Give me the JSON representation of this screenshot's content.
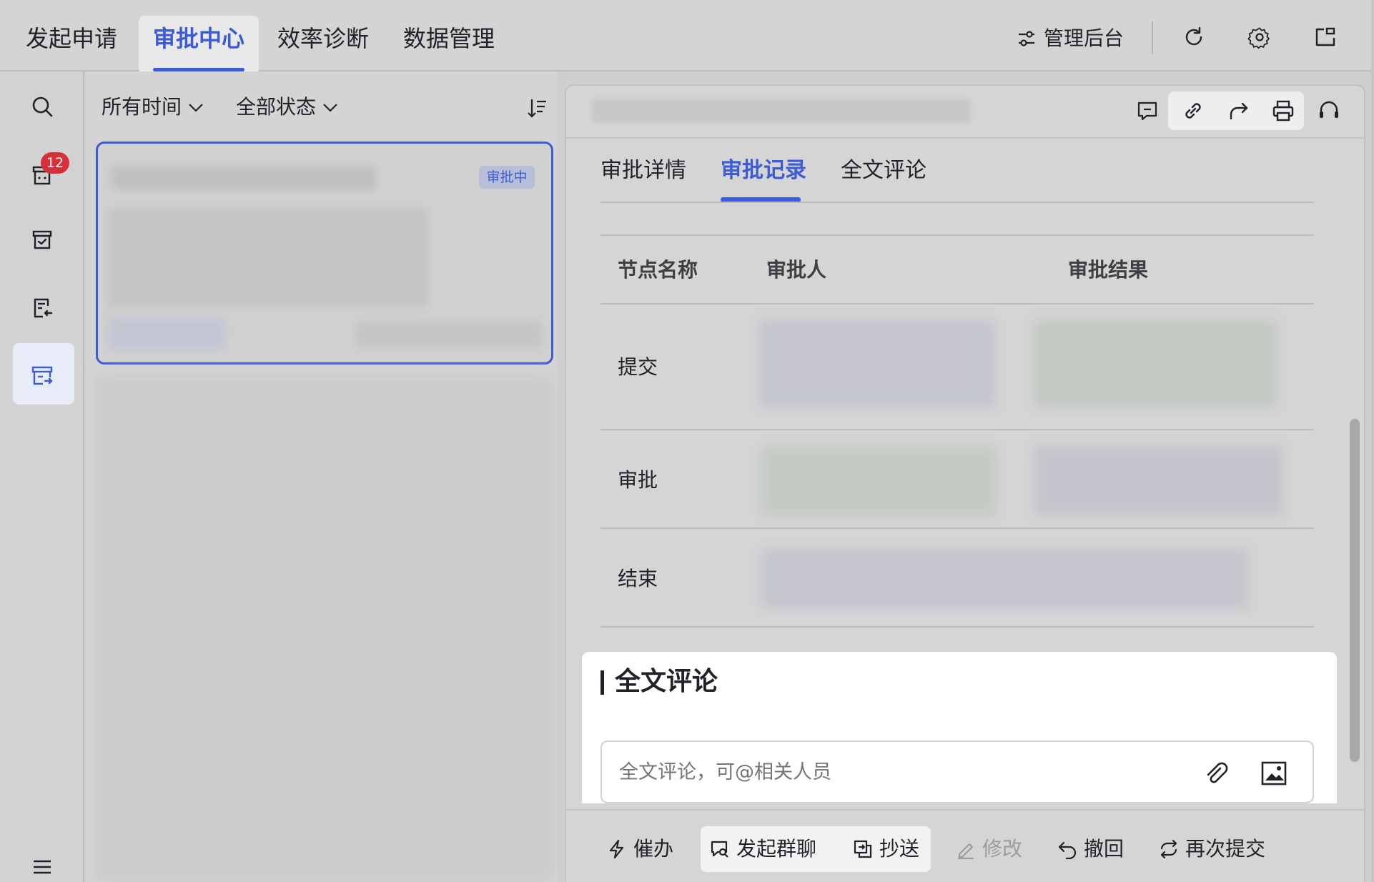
{
  "top_nav": {
    "tabs": [
      {
        "label": "发起申请",
        "active": false
      },
      {
        "label": "审批中心",
        "active": true
      },
      {
        "label": "效率诊断",
        "active": false
      },
      {
        "label": "数据管理",
        "active": false
      }
    ],
    "admin_label": "管理后台"
  },
  "rail": {
    "badge_count": "12"
  },
  "list": {
    "time_filter": "所有时间",
    "status_filter": "全部状态",
    "card_status": "审批中"
  },
  "detail": {
    "tabs": [
      {
        "label": "审批详情",
        "active": false
      },
      {
        "label": "审批记录",
        "active": true
      },
      {
        "label": "全文评论",
        "active": false
      }
    ],
    "table": {
      "headers": [
        "节点名称",
        "审批人",
        "审批结果"
      ],
      "rows": [
        {
          "node": "提交"
        },
        {
          "node": "审批"
        },
        {
          "node": "结束"
        }
      ]
    },
    "comment": {
      "title": "全文评论",
      "placeholder": "全文评论，可@相关人员"
    },
    "actions": {
      "urge": "催办",
      "group_chat": "发起群聊",
      "cc": "抄送",
      "edit": "修改",
      "withdraw": "撤回",
      "resubmit": "再次提交"
    }
  },
  "colors": {
    "accent": "#3c5bd4",
    "badge": "#d6303a"
  }
}
